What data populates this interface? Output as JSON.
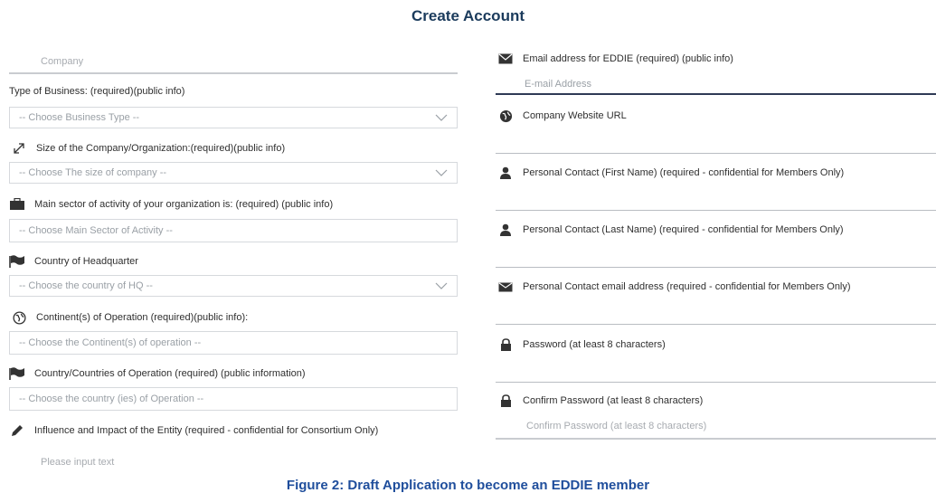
{
  "header": {
    "title": "Create Account"
  },
  "left": {
    "company_placeholder": "Company",
    "business_type": {
      "label": "Type of Business: (required)(public info)",
      "placeholder": "-- Choose Business Type --"
    },
    "company_size": {
      "label": "Size of the Company/Organization:(required)(public info)",
      "placeholder": "-- Choose The size of company --"
    },
    "main_sector": {
      "label": "Main sector of activity of your organization is: (required) (public info)",
      "placeholder": "-- Choose Main Sector of Activity --"
    },
    "hq_country": {
      "label": "Country of Headquarter",
      "placeholder": "-- Choose the country of HQ --"
    },
    "continents": {
      "label": "Continent(s) of Operation (required)(public info):",
      "placeholder": "-- Choose the Continent(s) of operation --"
    },
    "op_countries": {
      "label": "Country/Countries of Operation (required) (public information)",
      "placeholder": "-- Choose the country (ies) of Operation --"
    },
    "influence": {
      "label": "Influence and Impact of the Entity (required - confidential for Consortium Only)",
      "placeholder": "Please input text"
    }
  },
  "right": {
    "email": {
      "label": "Email address for EDDIE (required) (public info)",
      "placeholder": "E-mail Address"
    },
    "website": {
      "label": "Company Website URL"
    },
    "first_name": {
      "label": "Personal Contact (First Name) (required - confidential for Members Only)"
    },
    "last_name": {
      "label": "Personal Contact (Last Name) (required - confidential for Members Only)"
    },
    "contact_email": {
      "label": "Personal Contact email address (required - confidential for Members Only)"
    },
    "password": {
      "label": "Password (at least 8 characters)"
    },
    "confirm_password": {
      "label": "Confirm Password (at least 8 characters)",
      "placeholder": "Confirm Password (at least 8 characters)"
    }
  },
  "caption": "Figure 2: Draft Application to become an EDDIE member",
  "colors": {
    "title": "#1b3b5c",
    "caption": "#1f4e9c",
    "border": "#d6d9dd",
    "focus_line": "#2f3a55"
  },
  "icons": [
    "chevron-down-icon",
    "resize-arrow-icon",
    "briefcase-icon",
    "flag-icon",
    "globe-icon",
    "pencil-icon",
    "envelope-icon",
    "user-icon",
    "lock-icon"
  ]
}
